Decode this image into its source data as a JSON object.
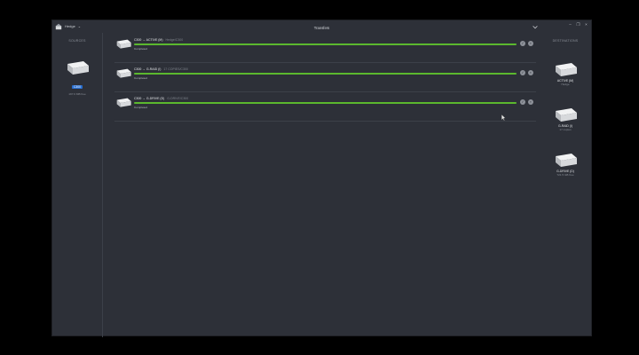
{
  "app": {
    "menu_label": "Hedge",
    "menu_caret": "⌄"
  },
  "window": {
    "title": "Transfers",
    "controls": [
      "–",
      "❐",
      "×"
    ]
  },
  "sources": {
    "heading": "SOURCES",
    "drive": {
      "badge": "C300",
      "sub": "197.6 MB free"
    }
  },
  "destinations": {
    "heading": "DESTINATIONS",
    "drives": [
      {
        "name": "ACTIVE (M)",
        "sub": "Hedge"
      },
      {
        "name": "G-RAID (I)",
        "sub": "17 copies"
      },
      {
        "name": "G-DRIVE (D)",
        "sub": "721.5 GB free"
      }
    ]
  },
  "transfers": [
    {
      "source": "C300",
      "arrow": "→",
      "target": "ACTIVE (M)",
      "path": "Hedge/C300",
      "status": "Completed",
      "progress": 100
    },
    {
      "source": "C300",
      "arrow": "→",
      "target": "G-RAID (I)",
      "path": "17 COPIES/C300",
      "status": "Completed",
      "progress": 100
    },
    {
      "source": "C300",
      "arrow": "→",
      "target": "G-DRIVE (D)",
      "path": "G-DRIVE/C300",
      "status": "Completed",
      "progress": 100
    }
  ],
  "icons": {
    "row_button_1": "check-icon",
    "row_button_2": "folder-icon",
    "drive": "hard-drive-icon"
  },
  "colors": {
    "progress": "#5bb82e",
    "badge": "#2a6fd0",
    "background": "#2d3038"
  }
}
